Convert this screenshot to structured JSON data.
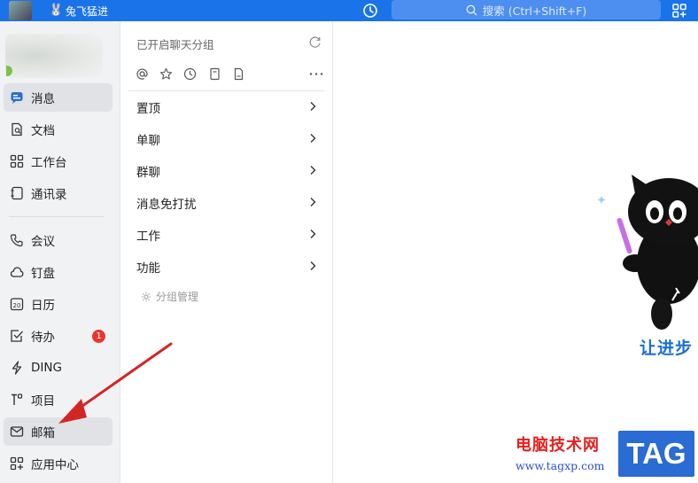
{
  "topbar": {
    "workspace_name": "兔飞猛进",
    "search_placeholder": "搜索 (Ctrl+Shift+F)"
  },
  "nav": {
    "items": [
      {
        "label": "消息",
        "icon": "chat-bubble-icon",
        "active": true
      },
      {
        "label": "文档",
        "icon": "document-icon"
      },
      {
        "label": "工作台",
        "icon": "grid-icon"
      },
      {
        "label": "通讯录",
        "icon": "contacts-icon"
      },
      {
        "label": "会议",
        "icon": "phone-icon"
      },
      {
        "label": "钉盘",
        "icon": "cloud-icon"
      },
      {
        "label": "日历",
        "icon": "calendar-icon",
        "calendar_day": "20"
      },
      {
        "label": "待办",
        "icon": "checkbox-icon",
        "badge": "1"
      },
      {
        "label": "DING",
        "icon": "lightning-icon"
      },
      {
        "label": "项目",
        "icon": "project-icon"
      },
      {
        "label": "邮箱",
        "icon": "mail-icon",
        "highlight": true
      },
      {
        "label": "应用中心",
        "icon": "app-center-icon"
      }
    ]
  },
  "mid": {
    "header": "已开启聊天分组",
    "filters": [
      "at-icon",
      "star-icon",
      "clock-icon",
      "bookmark-icon",
      "file-icon",
      "more-icon"
    ],
    "groups": [
      "置顶",
      "单聊",
      "群聊",
      "消息免打扰",
      "工作",
      "功能"
    ],
    "group_manage": "分组管理"
  },
  "right": {
    "slogan": "让进步"
  },
  "watermark": {
    "site_name": "电脑技术网",
    "url": "www.tagxp.com",
    "tag": "TAG"
  },
  "colors": {
    "topbar": "#1a73e8",
    "accent": "#1a6fd6",
    "badge": "#e8362f",
    "arrow": "#d42525"
  }
}
